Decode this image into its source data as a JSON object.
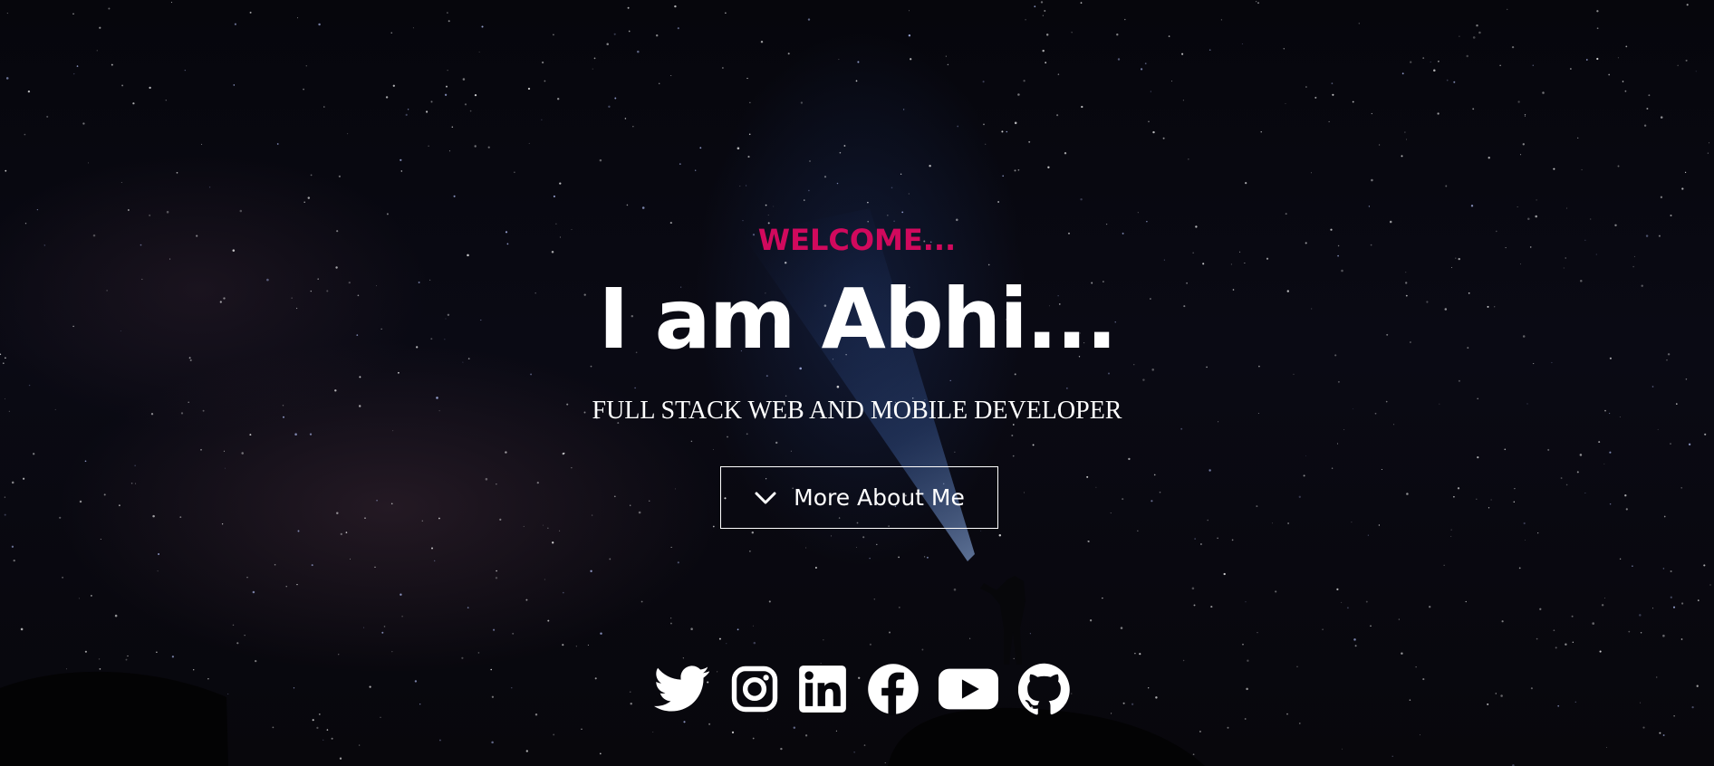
{
  "hero": {
    "welcome": "WELCOME...",
    "headline": "I am Abhi...",
    "subtitle": "FULL STACK WEB AND MOBILE DEVELOPER",
    "cta_label": "More About Me"
  },
  "socials": [
    {
      "icon": "twitter-icon"
    },
    {
      "icon": "instagram-icon"
    },
    {
      "icon": "linkedin-icon"
    },
    {
      "icon": "facebook-icon"
    },
    {
      "icon": "youtube-icon"
    },
    {
      "icon": "github-icon"
    }
  ],
  "colors": {
    "accent": "#d1095d",
    "text": "#ffffff",
    "background": "#05050a"
  }
}
